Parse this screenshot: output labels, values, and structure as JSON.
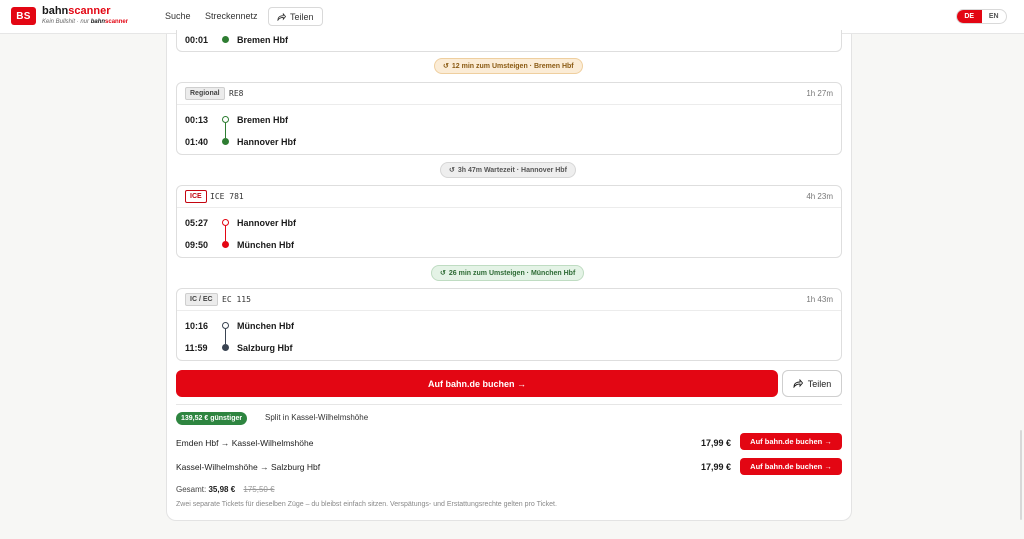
{
  "header": {
    "logo_text": "BS",
    "brand_prefix": "bahn",
    "brand_suffix": "scanner",
    "tagline_prefix": "Kein Bullshit · nur ",
    "tagline_brand_a": "bahn",
    "tagline_brand_b": "scanner",
    "nav": {
      "search": "Suche",
      "network": "Streckennetz",
      "share": "Teilen"
    },
    "lang": {
      "de": "DE",
      "en": "EN",
      "active": "DE"
    }
  },
  "journey": {
    "top_leg": {
      "arrival_time": "00:01",
      "arrival_station": "Bremen Hbf"
    },
    "transfers": [
      {
        "text": "12 min zum Umsteigen · Bremen Hbf",
        "style": "orange"
      },
      {
        "text": "3h 47m Wartezeit · Hannover Hbf",
        "style": "grey"
      },
      {
        "text": "26 min zum Umsteigen · München Hbf",
        "style": "green"
      }
    ],
    "legs": [
      {
        "badge": "Regional",
        "train": "RE8",
        "duration": "1h 27m",
        "dep_time": "00:13",
        "dep_station": "Bremen Hbf",
        "arr_time": "01:40",
        "arr_station": "Hannover Hbf",
        "color": "#2e7d32"
      },
      {
        "badge": "ICE",
        "train": "ICE 781",
        "duration": "4h 23m",
        "dep_time": "05:27",
        "dep_station": "Hannover Hbf",
        "arr_time": "09:50",
        "arr_station": "München Hbf",
        "color": "#e30613"
      },
      {
        "badge": "IC / EC",
        "train": "EC 115",
        "duration": "1h 43m",
        "dep_time": "10:16",
        "dep_station": "München Hbf",
        "arr_time": "11:59",
        "arr_station": "Salzburg Hbf",
        "color": "#3a4452"
      }
    ]
  },
  "actions": {
    "book_label": "Auf bahn.de buchen →",
    "share_label": "Teilen"
  },
  "split": {
    "savings_badge": "139,52 € günstiger",
    "split_label": "Split in Kassel-Wilhelmshöhe",
    "segments": [
      {
        "route": "Emden Hbf → Kassel-Wilhelmshöhe",
        "price": "17,99 €",
        "button": "Auf bahn.de buchen →"
      },
      {
        "route": "Kassel-Wilhelmshöhe → Salzburg Hbf",
        "price": "17,99 €",
        "button": "Auf bahn.de buchen →"
      }
    ],
    "total_label": "Gesamt:",
    "total_value": "35,98 €",
    "total_old": "175,50 €",
    "note": "Zwei separate Tickets für dieselben Züge – du bleibst einfach sitzen. Verspätungs- und Erstattungsrechte gelten pro Ticket."
  },
  "colors": {
    "brand_red": "#e30613",
    "savings_green": "#2e8540"
  }
}
